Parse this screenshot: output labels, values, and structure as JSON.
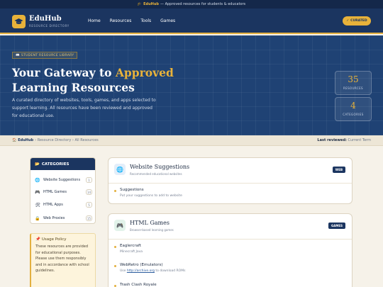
{
  "announcement": {
    "brand": "EduHub",
    "text": "— Approved resources for students & educators",
    "icon": "graduation-cap-icon"
  },
  "nav": {
    "logo_title": "EduHub",
    "logo_subtitle": "RESOURCE DIRECTORY",
    "links": [
      "Home",
      "Resources",
      "Tools",
      "Games"
    ],
    "curated_label": "CURATED"
  },
  "hero": {
    "badge": "STUDENT RESOURCE LIBRARY",
    "title_line1_pre": "Your Gateway to ",
    "title_line1_accent": "Approved",
    "title_line2": "Learning Resources",
    "description": "A curated directory of websites, tools, games, and apps selected to support learning. All resources have been reviewed and approved for educational use.",
    "stats": [
      {
        "value": "35",
        "label": "RESOURCES"
      },
      {
        "value": "4",
        "label": "CATEGORIES"
      }
    ]
  },
  "breadcrumb": {
    "home": "EduHub",
    "path": "› Resource Directory › All Resources",
    "reviewed_label": "Last reviewed:",
    "reviewed_value": "Current Term"
  },
  "sidebar": {
    "title": "CATEGORIES",
    "items": [
      {
        "label": "Website Suggestions",
        "count": "1",
        "icon": "globe-icon"
      },
      {
        "label": "HTML Games",
        "count": "14",
        "icon": "gamepad-icon"
      },
      {
        "label": "HTML Apps",
        "count": "5",
        "icon": "tools-icon"
      },
      {
        "label": "Web Proxies",
        "count": "15",
        "icon": "lock-icon"
      }
    ],
    "policy_title": "Usage Policy",
    "policy_text": "These resources are provided for educational purposes. Please use them responsibly and in accordance with school guidelines."
  },
  "sections": [
    {
      "title": "Website Suggestions",
      "subtitle": "Recommended educational websites",
      "tag": "WEB",
      "items": [
        {
          "name": "Suggestions",
          "desc": "Put your suggestions to add to website"
        }
      ]
    },
    {
      "title": "HTML Games",
      "subtitle": "Browser-based learning games",
      "tag": "GAMES",
      "items": [
        {
          "name": "Eaglercraft",
          "desc": "Minecraft Java"
        },
        {
          "name": "WebRetro (Emulators)",
          "desc_pre": "Use ",
          "desc_link": "http://archive.org",
          "desc_post": " to download ROMs"
        },
        {
          "name": "Trash Clash Royale",
          "desc": ""
        }
      ]
    }
  ],
  "colors": {
    "navy": "#1b3560",
    "gold": "#e8b23a",
    "cream": "#f6f2e9"
  }
}
